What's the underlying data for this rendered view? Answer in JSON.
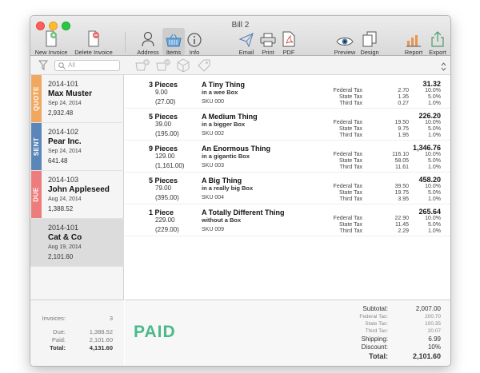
{
  "window": {
    "title": "Bill 2"
  },
  "toolbar": {
    "new_invoice": "New Invoice",
    "delete_invoice": "Delete Invoice",
    "address": "Address",
    "items": "Items",
    "info": "Info",
    "email": "Email",
    "print": "Print",
    "pdf": "PDF",
    "preview": "Preview",
    "design": "Design",
    "report": "Report",
    "export": "Export"
  },
  "search": {
    "placeholder": "All"
  },
  "invoices": [
    {
      "status": "QUOTE",
      "status_color": "#f0a860",
      "number": "2014-101",
      "customer": "Max Muster",
      "date": "Sep 24, 2014",
      "amount": "2,932.48"
    },
    {
      "status": "SENT",
      "status_color": "#5b86b9",
      "number": "2014-102",
      "customer": "Pear Inc.",
      "date": "Sep 24, 2014",
      "amount": "641.48"
    },
    {
      "status": "DUE",
      "status_color": "#ee7c7c",
      "number": "2014-103",
      "customer": "John Appleseed",
      "date": "Aug 24, 2014",
      "amount": "1,388.52"
    },
    {
      "status": "",
      "status_color": "",
      "number": "2014-101",
      "customer": "Cat & Co",
      "date": "Aug 19, 2014",
      "amount": "2,101.60"
    }
  ],
  "sidebar_summary": {
    "invoices_label": "Invoices:",
    "invoices_value": "3",
    "due_label": "Due:",
    "due_value": "1,388.52",
    "paid_label": "Paid:",
    "paid_value": "2,101.60",
    "total_label": "Total:",
    "total_value": "4,131.60"
  },
  "items": [
    {
      "qty": "3 Pieces",
      "unit_price": "9.00",
      "line_total_paren": "(27.00)",
      "name": "A Tiny Thing",
      "desc": "in a wee Box",
      "sku": "SKU 000",
      "total": "31.32",
      "taxes": [
        {
          "name": "Federal Tax",
          "amount": "2.70",
          "rate": "10.0%"
        },
        {
          "name": "State Tax",
          "amount": "1.35",
          "rate": "5.0%"
        },
        {
          "name": "Third Tax",
          "amount": "0.27",
          "rate": "1.0%"
        }
      ]
    },
    {
      "qty": "5 Pieces",
      "unit_price": "39.00",
      "line_total_paren": "(195.00)",
      "name": "A Medium Thing",
      "desc": "in a bigger Box",
      "sku": "SKU 002",
      "total": "226.20",
      "taxes": [
        {
          "name": "Federal Tax",
          "amount": "19.50",
          "rate": "10.0%"
        },
        {
          "name": "State Tax",
          "amount": "9.75",
          "rate": "5.0%"
        },
        {
          "name": "Third Tax",
          "amount": "1.95",
          "rate": "1.0%"
        }
      ]
    },
    {
      "qty": "9 Pieces",
      "unit_price": "129.00",
      "line_total_paren": "(1,161.00)",
      "name": "An Enormous Thing",
      "desc": "in a gigantic Box",
      "sku": "SKU 003",
      "total": "1,346.76",
      "taxes": [
        {
          "name": "Federal Tax",
          "amount": "116.10",
          "rate": "10.0%"
        },
        {
          "name": "State Tax",
          "amount": "58.05",
          "rate": "5.0%"
        },
        {
          "name": "Third Tax",
          "amount": "11.61",
          "rate": "1.0%"
        }
      ]
    },
    {
      "qty": "5 Pieces",
      "unit_price": "79.00",
      "line_total_paren": "(395.00)",
      "name": "A Big Thing",
      "desc": "in a really big Box",
      "sku": "SKU 004",
      "total": "458.20",
      "taxes": [
        {
          "name": "Federal Tax",
          "amount": "39.50",
          "rate": "10.0%"
        },
        {
          "name": "State Tax",
          "amount": "19.75",
          "rate": "5.0%"
        },
        {
          "name": "Third Tax",
          "amount": "3.95",
          "rate": "1.0%"
        }
      ]
    },
    {
      "qty": "1 Piece",
      "unit_price": "229.00",
      "line_total_paren": "(229.00)",
      "name": "A Totally Different Thing",
      "desc": "without a Box",
      "sku": "SKU 009",
      "total": "265.64",
      "taxes": [
        {
          "name": "Federal Tax",
          "amount": "22.90",
          "rate": "10.0%"
        },
        {
          "name": "State Tax",
          "amount": "11.45",
          "rate": "5.0%"
        },
        {
          "name": "Third Tax",
          "amount": "2.29",
          "rate": "1.0%"
        }
      ]
    }
  ],
  "totals": {
    "paid_stamp": "PAID",
    "subtotal_label": "Subtotal:",
    "subtotal_value": "2,007.00",
    "federal_label": "Federal Tax:",
    "federal_value": "200.70",
    "state_label": "State Tax:",
    "state_value": "100.35",
    "third_label": "Third Tax:",
    "third_value": "20.07",
    "shipping_label": "Shipping:",
    "shipping_value": "6.99",
    "discount_label": "Discount:",
    "discount_value": "10%",
    "total_label": "Total:",
    "total_value": "2,101.60"
  }
}
